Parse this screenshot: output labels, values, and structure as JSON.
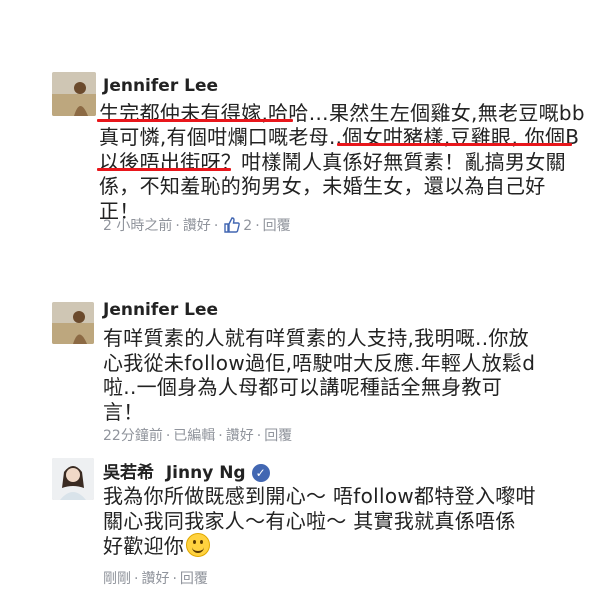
{
  "comments": [
    {
      "author": "Jennifer Lee",
      "lines": [
        "生完都仲未有得嫁,哈哈…果然生左個雞女,無老豆嘅bb",
        "真可憐,有個咁爛口嘅老母..個女咁豬樣,豆雞眼, 你個B",
        "以後唔出街呀？咁樣鬧人真係好無質素！亂搞男女關",
        "係，不知羞恥的狗男女，未婚生女，還以為自己好",
        "正！"
      ],
      "meta": {
        "time": "2 小時之前",
        "like": "讚好",
        "like_count": "2",
        "reply": "回覆"
      }
    },
    {
      "author": "Jennifer Lee",
      "lines": [
        "有咩質素的人就有咩質素的人支持,我明嘅..你放",
        "心我從未follow過佢,唔駛咁大反應.年輕人放鬆d",
        "啦..一個身為人母都可以講呢種話全無身教可",
        "言！"
      ],
      "meta": {
        "time": "22分鐘前",
        "edited": "已編輯",
        "like": "讚好",
        "reply": "回覆"
      }
    },
    {
      "author": "吳若希  Jinny Ng",
      "lines": [
        "我為你所做既感到開心～ 唔follow都特登入嚟咁",
        "關心我同我家人～有心啦～ 其實我就真係唔係",
        "好歡迎你"
      ],
      "meta": {
        "time": "剛剛",
        "like": "讚好",
        "reply": "回覆"
      }
    }
  ],
  "colors": {
    "underline": "#e8161b",
    "meta": "#90949c",
    "verified": "#4267b2"
  },
  "icons": [
    "thumbs-up-icon",
    "verified-badge-icon",
    "smile-emoji-icon"
  ]
}
